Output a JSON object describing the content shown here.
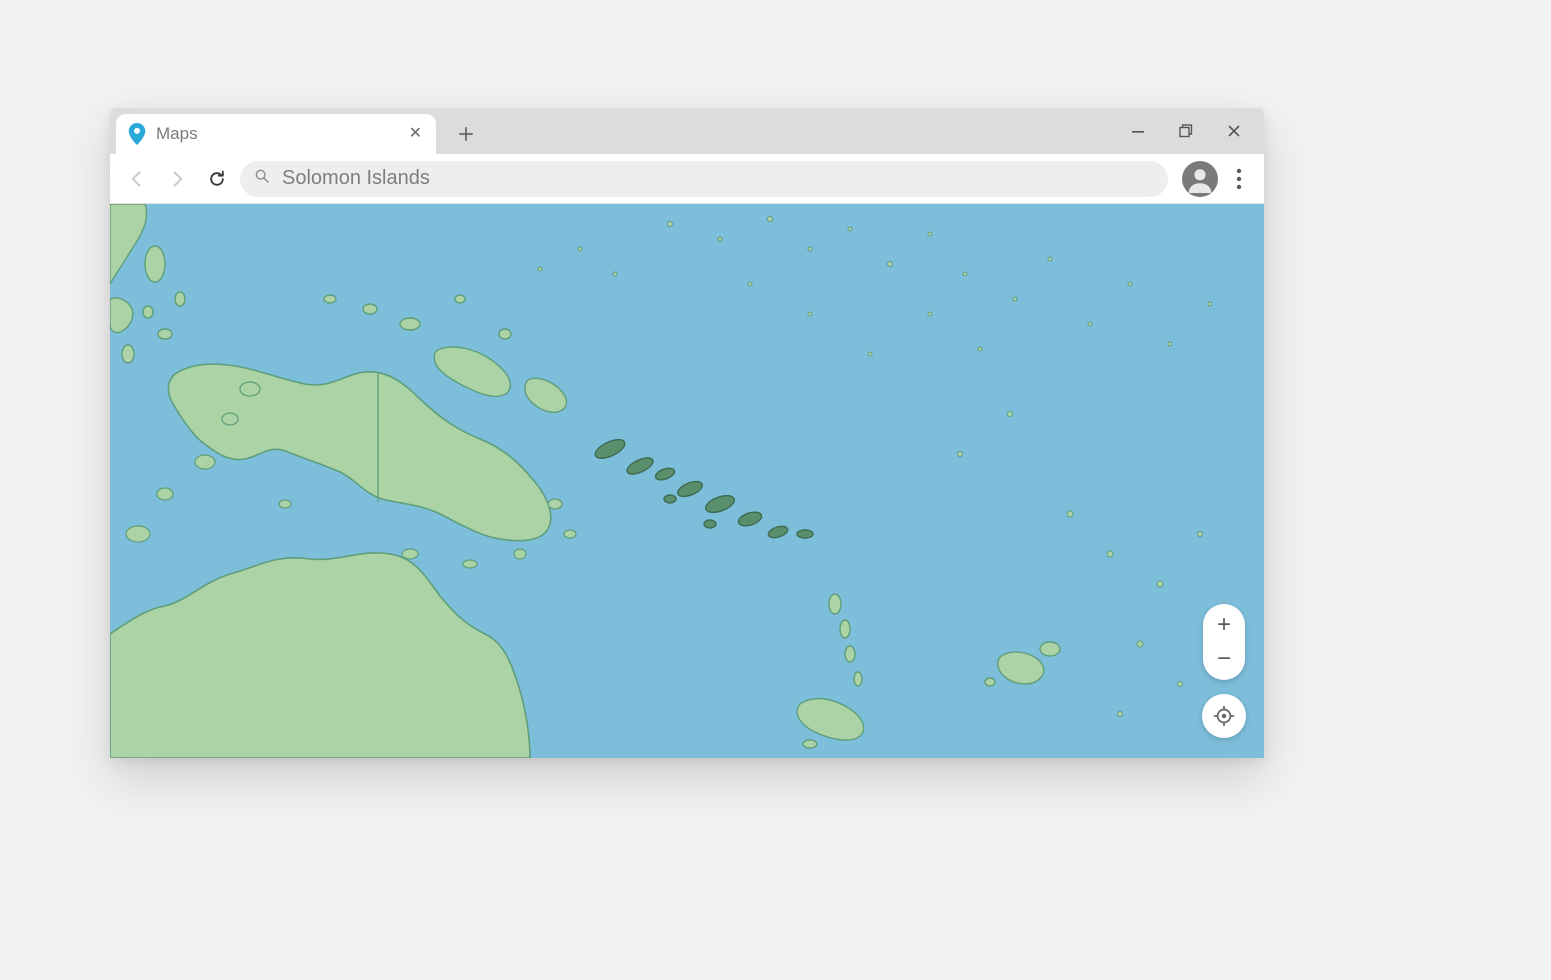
{
  "tab": {
    "title": "Maps",
    "icon": "map-pin-icon"
  },
  "addressbar": {
    "value": "Solomon Islands"
  },
  "map": {
    "region_focus": "Solomon Islands",
    "highlight_color": "#5a8f6e",
    "land_color": "#abd3a6",
    "land_stroke": "#5f9e7a",
    "ocean_color": "#7dbedb",
    "controls": {
      "zoom_in": "+",
      "zoom_out": "−"
    }
  }
}
